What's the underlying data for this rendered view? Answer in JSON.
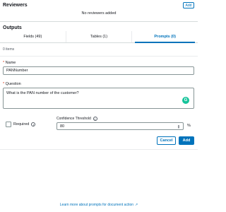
{
  "reviewers": {
    "title": "Reviewers",
    "add_label": "Add",
    "empty_text": "No reviewers added"
  },
  "outputs": {
    "title": "Outputs",
    "tabs": [
      {
        "label": "Fields (49)"
      },
      {
        "label": "Tables (1)"
      },
      {
        "label": "Prompts (0)"
      }
    ],
    "items_count": "0 items"
  },
  "form": {
    "name_label": "Name",
    "name_value": "PANNumber",
    "question_label": "Question",
    "question_value": "What is the PAN number of the customer?",
    "required_label": "Required",
    "confidence_label": "Confidence Threshold",
    "confidence_value": "80",
    "percent": "%",
    "cancel_label": "Cancel",
    "add_label": "Add"
  },
  "footer": {
    "learn_more": "Learn more about prompts for document action"
  },
  "colors": {
    "accent": "#0073bb",
    "required": "#d13212",
    "grammarly": "#15c39a"
  }
}
